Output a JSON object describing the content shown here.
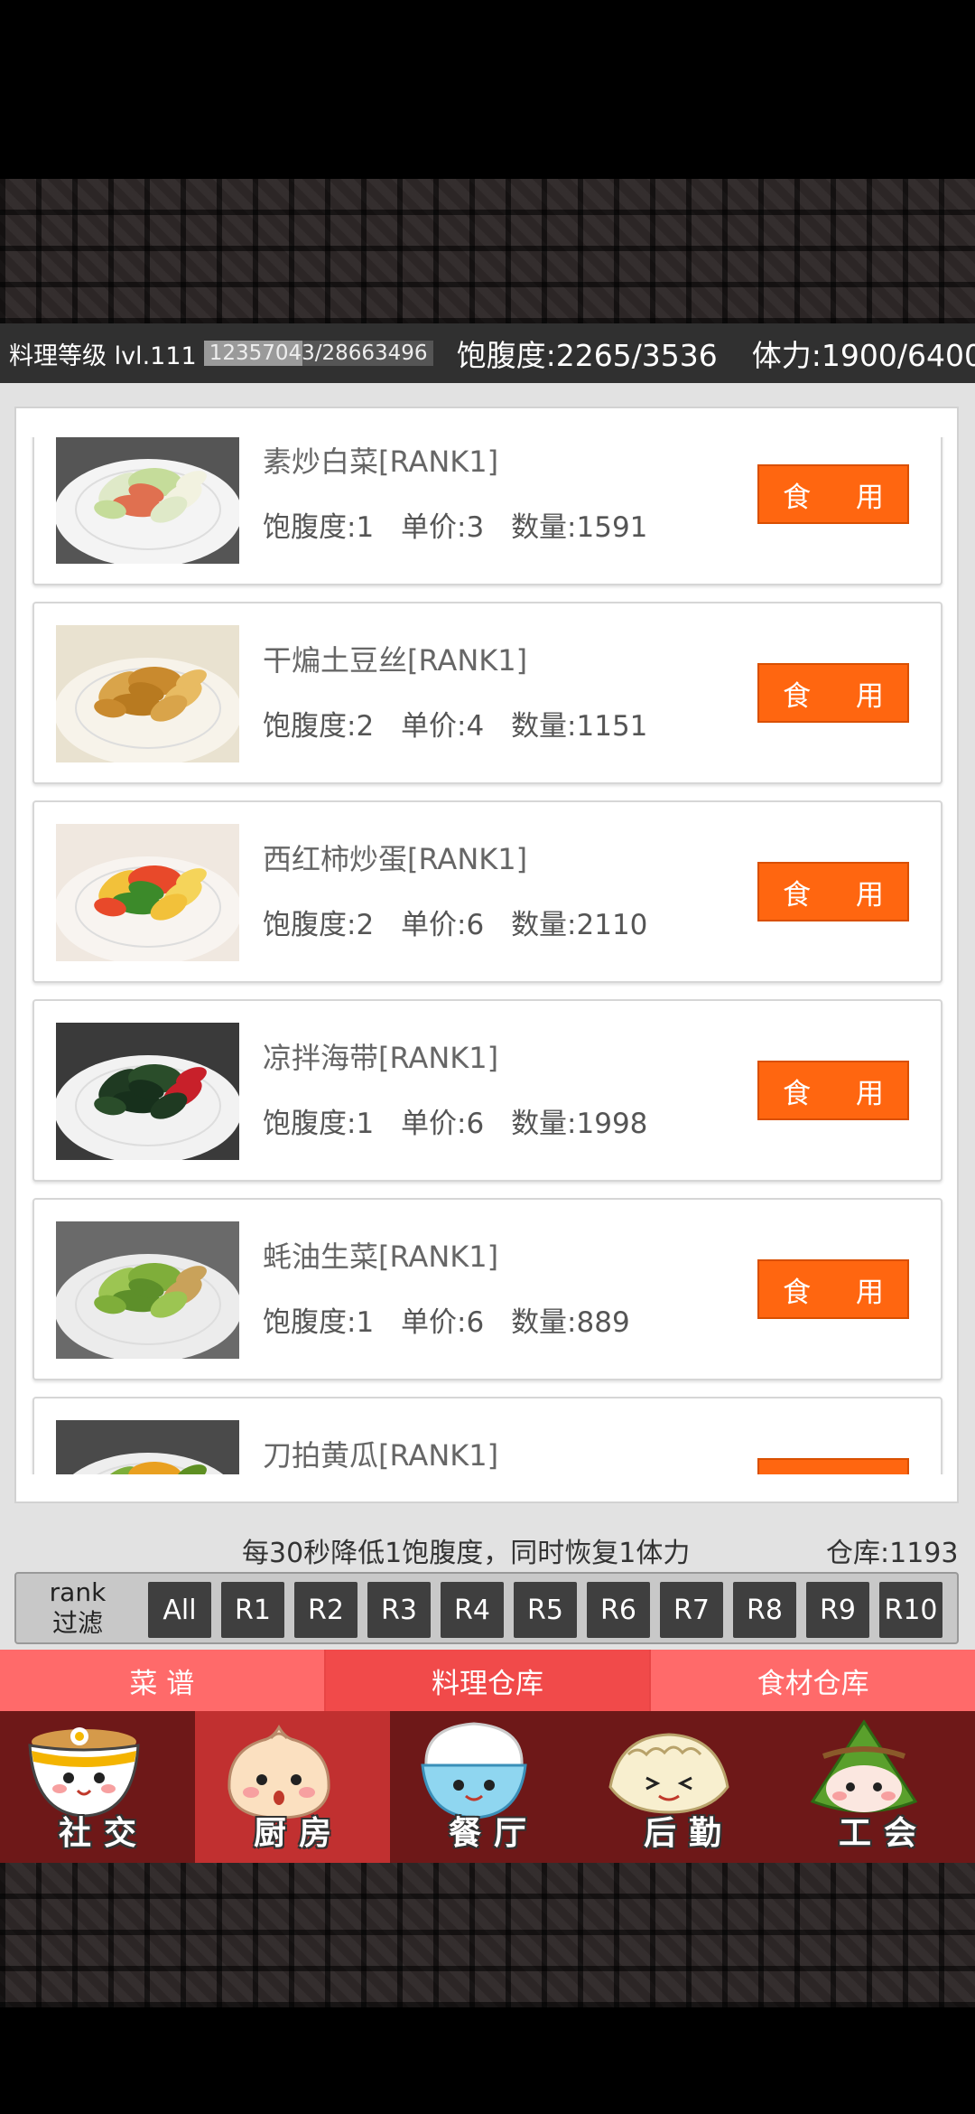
{
  "status": {
    "level_label": "料理等级 lvl.111",
    "exp_text": "12357043/28663496",
    "exp_progress": 0.431,
    "satiety": "饱腹度:2265/3536",
    "stamina": "体力:1900/6400"
  },
  "food_labels": {
    "satiety": "饱腹度",
    "price": "单价",
    "quantity": "数量",
    "eat": "食 用"
  },
  "foods": [
    {
      "name": "素炒白菜[RANK1]",
      "satiety": "1",
      "price": "3",
      "quantity": "1591"
    },
    {
      "name": "干煸土豆丝[RANK1]",
      "satiety": "2",
      "price": "4",
      "quantity": "1151"
    },
    {
      "name": "西红柿炒蛋[RANK1]",
      "satiety": "2",
      "price": "6",
      "quantity": "2110"
    },
    {
      "name": "凉拌海带[RANK1]",
      "satiety": "1",
      "price": "6",
      "quantity": "1998"
    },
    {
      "name": "蚝油生菜[RANK1]",
      "satiety": "1",
      "price": "6",
      "quantity": "889"
    },
    {
      "name": "刀拍黄瓜[RANK1]",
      "satiety": "",
      "price": "",
      "quantity": ""
    }
  ],
  "hint": "每30秒降低1饱腹度，同时恢复1体力",
  "storage": "仓库:1193",
  "rank_filter": {
    "label": "rank\n过滤",
    "label_line1": "rank",
    "label_line2": "过滤",
    "buttons": [
      "All",
      "R1",
      "R2",
      "R3",
      "R4",
      "R5",
      "R6",
      "R7",
      "R8",
      "R9",
      "R10"
    ]
  },
  "tabs": [
    "菜 谱",
    "料理仓库",
    "食材仓库"
  ],
  "active_tab": 1,
  "nav": [
    {
      "label": "社交",
      "icon": "bowl-mascot-icon"
    },
    {
      "label": "厨房",
      "icon": "bun-mascot-icon"
    },
    {
      "label": "餐厅",
      "icon": "rice-mascot-icon"
    },
    {
      "label": "后勤",
      "icon": "dumpling-mascot-icon"
    },
    {
      "label": "工会",
      "icon": "zongzi-mascot-icon"
    }
  ],
  "active_nav": 1,
  "colors": {
    "accent": "#ff6610",
    "tab": "#ff6a6a",
    "nav": "#6e1818",
    "nav_active": "#c13030"
  }
}
